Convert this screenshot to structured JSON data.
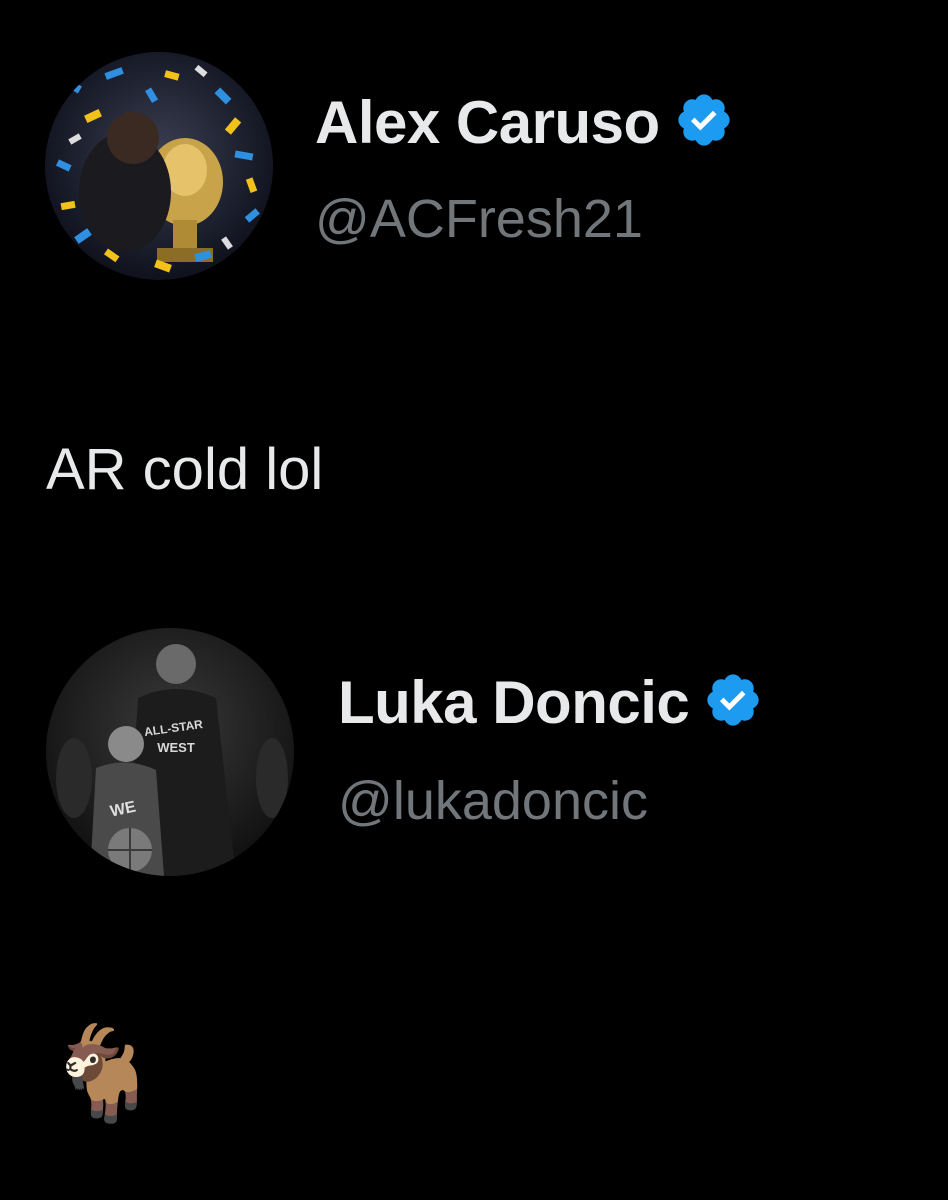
{
  "colors": {
    "background": "#000000",
    "primary_text": "#e7e9ea",
    "secondary_text": "#71767b",
    "verified_badge": "#1d9bf0"
  },
  "tweets": [
    {
      "display_name": "Alex Caruso",
      "handle": "@ACFresh21",
      "verified": true,
      "verified_icon": "verified-badge-icon",
      "avatar_icon": "profile-avatar",
      "text": "AR cold lol"
    },
    {
      "display_name": "Luka Doncic",
      "handle": "@lukadoncic",
      "verified": true,
      "verified_icon": "verified-badge-icon",
      "avatar_icon": "profile-avatar",
      "text": "🐐"
    }
  ]
}
